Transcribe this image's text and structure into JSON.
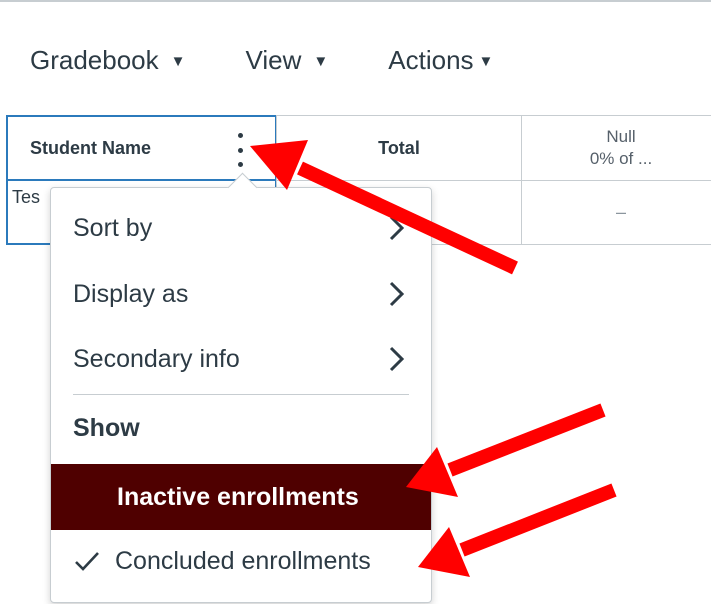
{
  "toolbar": {
    "gradebook_label": "Gradebook",
    "view_label": "View",
    "actions_label": "Actions",
    "caret_icon": "caret-down-icon"
  },
  "grid": {
    "columns": [
      {
        "label": "Student Name"
      },
      {
        "label": "Total"
      },
      {
        "label": "Null",
        "sublabel": "0% of ..."
      }
    ],
    "rows": [
      {
        "student": "Tes",
        "total": "",
        "null": "–"
      }
    ]
  },
  "menu": {
    "items": [
      {
        "label": "Sort by",
        "icon": "chevron-right-icon"
      },
      {
        "label": "Display as",
        "icon": "chevron-right-icon"
      },
      {
        "label": "Secondary info",
        "icon": "chevron-right-icon"
      }
    ],
    "show_group_label": "Show",
    "options": [
      {
        "label": "Inactive enrollments",
        "checked": false,
        "highlighted": true
      },
      {
        "label": "Concluded enrollments",
        "checked": true,
        "highlighted": false
      }
    ]
  },
  "colors": {
    "highlight": "#4f0000",
    "focus_border": "#2b7abc",
    "annotation_arrow": "#ff0000",
    "text": "#2d3b45"
  }
}
